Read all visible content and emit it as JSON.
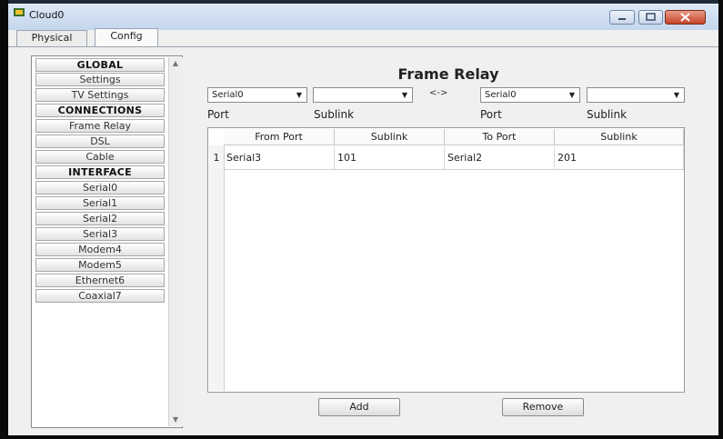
{
  "window": {
    "title": "Cloud0"
  },
  "tabs": [
    {
      "label": "Physical"
    },
    {
      "label": "Config"
    }
  ],
  "sidebar": {
    "items": [
      {
        "label": "GLOBAL",
        "header": true
      },
      {
        "label": "Settings"
      },
      {
        "label": "TV Settings"
      },
      {
        "label": "CONNECTIONS",
        "header": true
      },
      {
        "label": "Frame Relay"
      },
      {
        "label": "DSL"
      },
      {
        "label": "Cable"
      },
      {
        "label": "INTERFACE",
        "header": true
      },
      {
        "label": "Serial0"
      },
      {
        "label": "Serial1"
      },
      {
        "label": "Serial2"
      },
      {
        "label": "Serial3"
      },
      {
        "label": "Modem4"
      },
      {
        "label": "Modem5"
      },
      {
        "label": "Ethernet6"
      },
      {
        "label": "Coaxial7"
      }
    ]
  },
  "main": {
    "title": "Frame Relay",
    "from_port_value": "Serial0",
    "from_sublink_value": "",
    "separator": "<->",
    "to_port_value": "Serial0",
    "to_sublink_value": "",
    "labels": {
      "port_left": "Port",
      "sublink_left": "Sublink",
      "port_right": "Port",
      "sublink_right": "Sublink"
    },
    "table": {
      "columns": [
        "From Port",
        "Sublink",
        "To Port",
        "Sublink"
      ],
      "rows": [
        {
          "num": "1",
          "from_port": "Serial3",
          "from_sublink": "101",
          "to_port": "Serial2",
          "to_sublink": "201"
        }
      ]
    },
    "add_label": "Add",
    "remove_label": "Remove"
  },
  "icons": {
    "app": "cloud-app-icon",
    "minimize": "minimize-icon",
    "maximize": "maximize-icon",
    "close": "close-icon",
    "dropdown": "chevron-down-icon"
  },
  "colors": {
    "titlebar": "#c4d6ec",
    "close": "#c6442a"
  }
}
